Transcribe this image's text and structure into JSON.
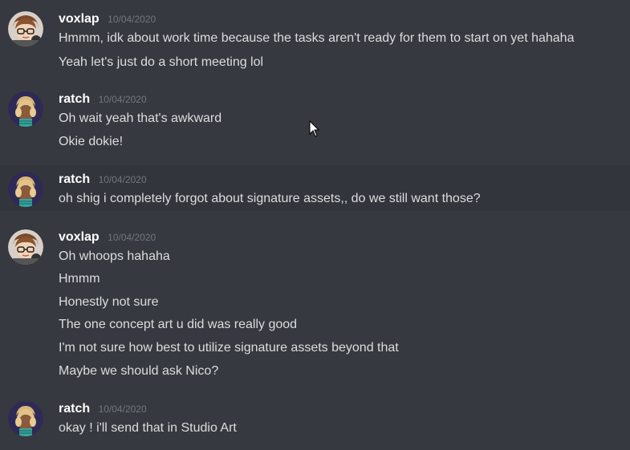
{
  "messages": [
    {
      "user": "voxlap",
      "time": "10/04/2020",
      "lines": [
        "Hmmm, idk about work time because the tasks aren't ready for them to start on yet hahaha",
        "Yeah let's just do a short meeting lol"
      ]
    },
    {
      "user": "ratch",
      "time": "10/04/2020",
      "lines": [
        "Oh wait yeah that's awkward",
        "Okie dokie!"
      ]
    },
    {
      "user": "ratch",
      "time": "10/04/2020",
      "lines": [
        "oh shig i completely forgot about signature assets,, do we still want those?"
      ]
    },
    {
      "user": "voxlap",
      "time": "10/04/2020",
      "lines": [
        "Oh whoops hahaha",
        "Hmmm",
        "Honestly not sure",
        "The one concept art u did was really good",
        "I'm not sure how best to utilize signature assets beyond that",
        "Maybe we should ask Nico?"
      ]
    },
    {
      "user": "ratch",
      "time": "10/04/2020",
      "lines": [
        "okay ! i'll send that in Studio Art"
      ]
    }
  ],
  "icons": {
    "avatar_voxlap": "avatar-voxlap-icon",
    "avatar_ratch": "avatar-ratch-icon",
    "cursor": "mouse-cursor-icon"
  },
  "colors": {
    "background": "#36393f",
    "hover_background": "#32353b",
    "username": "#ffffff",
    "timestamp": "#72767d",
    "message_text": "#dcddde"
  }
}
